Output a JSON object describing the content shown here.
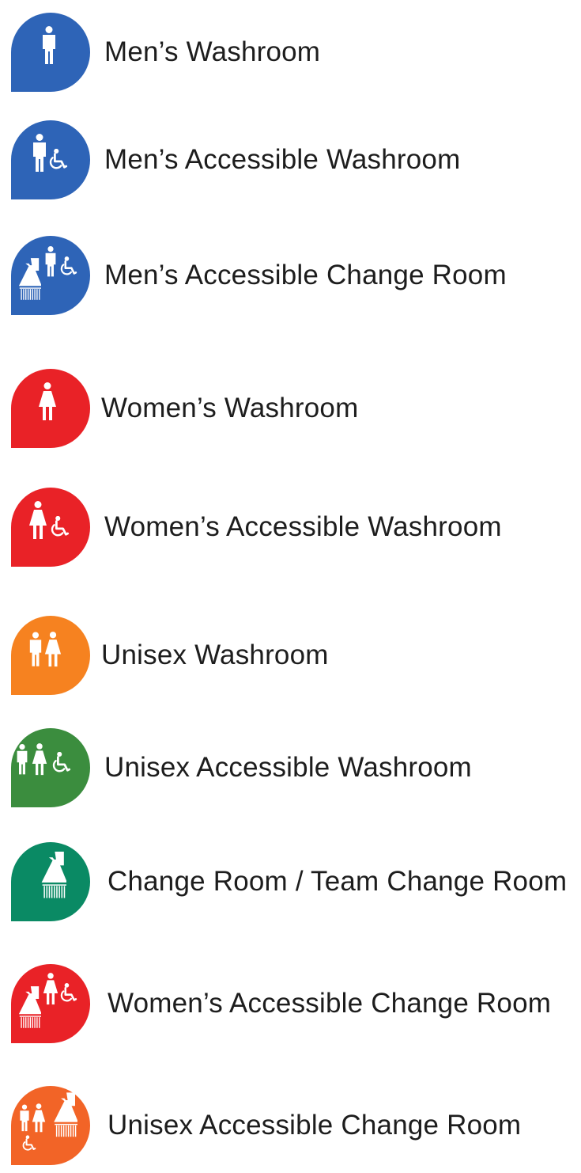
{
  "items": [
    {
      "label": "Men’s Washroom",
      "color": "#2e64b7",
      "icon": "male-icon"
    },
    {
      "label": "Men’s Accessible Washroom",
      "color": "#2e64b7",
      "icon": "male-accessible-icon"
    },
    {
      "label": "Men’s Accessible Change Room",
      "color": "#2e64b7",
      "icon": "male-accessible-shower-icon"
    },
    {
      "label": "Women’s Washroom",
      "color": "#e92227",
      "icon": "female-icon"
    },
    {
      "label": "Women’s Accessible Washroom",
      "color": "#e92227",
      "icon": "female-accessible-icon"
    },
    {
      "label": "Unisex Washroom",
      "color": "#f68220",
      "icon": "unisex-icon"
    },
    {
      "label": "Unisex Accessible Washroom",
      "color": "#3b8d3e",
      "icon": "unisex-accessible-icon"
    },
    {
      "label": "Change Room / Team Change Room",
      "color": "#0a8a64",
      "icon": "shower-icon"
    },
    {
      "label": "Women’s Accessible Change Room",
      "color": "#e92227",
      "icon": "female-accessible-shower-icon"
    },
    {
      "label": "Unisex Accessible Change Room",
      "color": "#f26427",
      "icon": "unisex-accessible-shower-icon"
    }
  ]
}
